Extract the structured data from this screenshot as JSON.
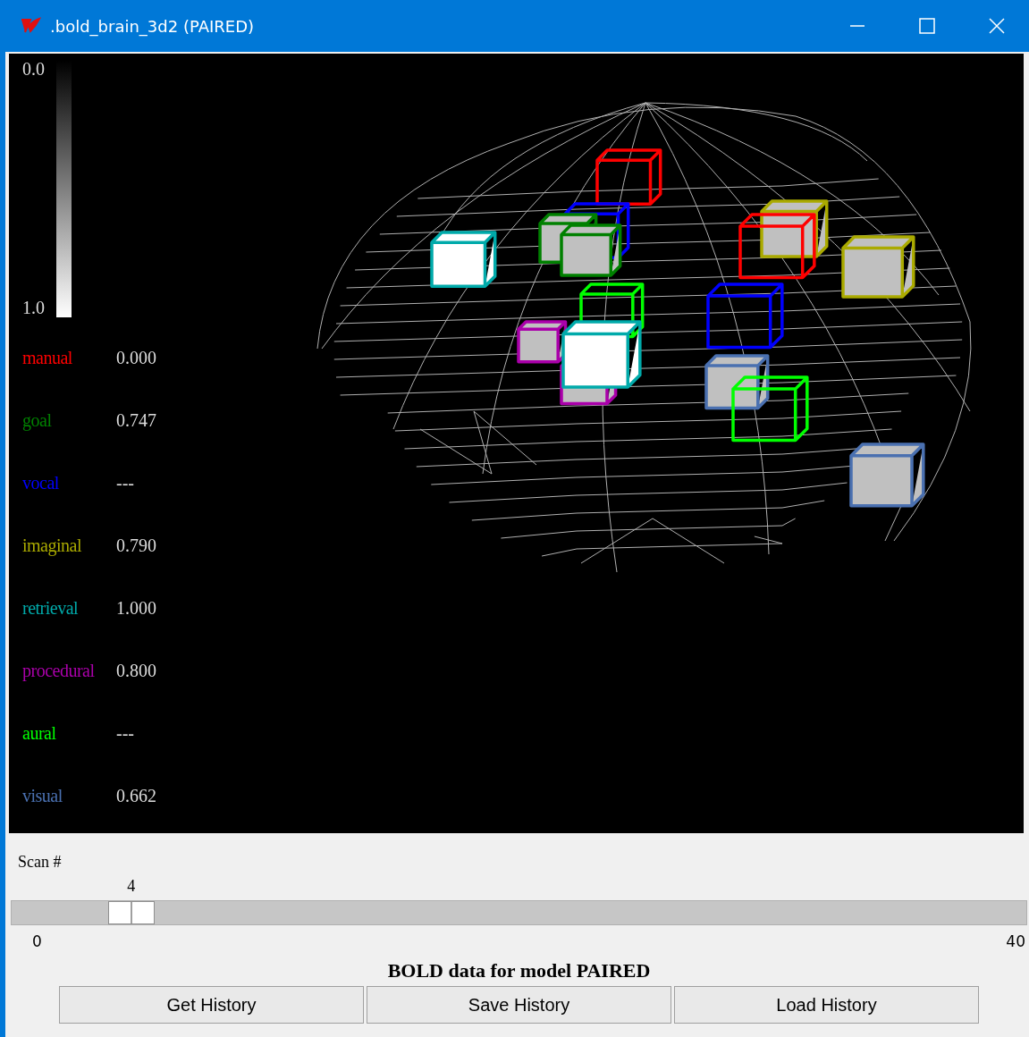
{
  "window": {
    "title": ".bold_brain_3d2 (PAIRED)"
  },
  "scale": {
    "top_label": "0.0",
    "bottom_label": "1.0"
  },
  "modules": [
    {
      "name": "manual",
      "value": "0.000",
      "color": "#ff0000"
    },
    {
      "name": "goal",
      "value": "0.747",
      "color": "#008000"
    },
    {
      "name": "vocal",
      "value": "---",
      "color": "#0000ff"
    },
    {
      "name": "imaginal",
      "value": "0.790",
      "color": "#aaaa00"
    },
    {
      "name": "retrieval",
      "value": "1.000",
      "color": "#00aaaa"
    },
    {
      "name": "procedural",
      "value": "0.800",
      "color": "#aa00aa"
    },
    {
      "name": "aural",
      "value": "---",
      "color": "#00ff00"
    },
    {
      "name": "visual",
      "value": "0.662",
      "color": "#4a70b0"
    }
  ],
  "scan": {
    "label": "Scan #",
    "value": "4",
    "level": 0.1,
    "min": "0",
    "max": "40"
  },
  "caption": "BOLD data for model PAIRED",
  "buttons": [
    "Get History",
    "Save History",
    "Load History"
  ]
}
